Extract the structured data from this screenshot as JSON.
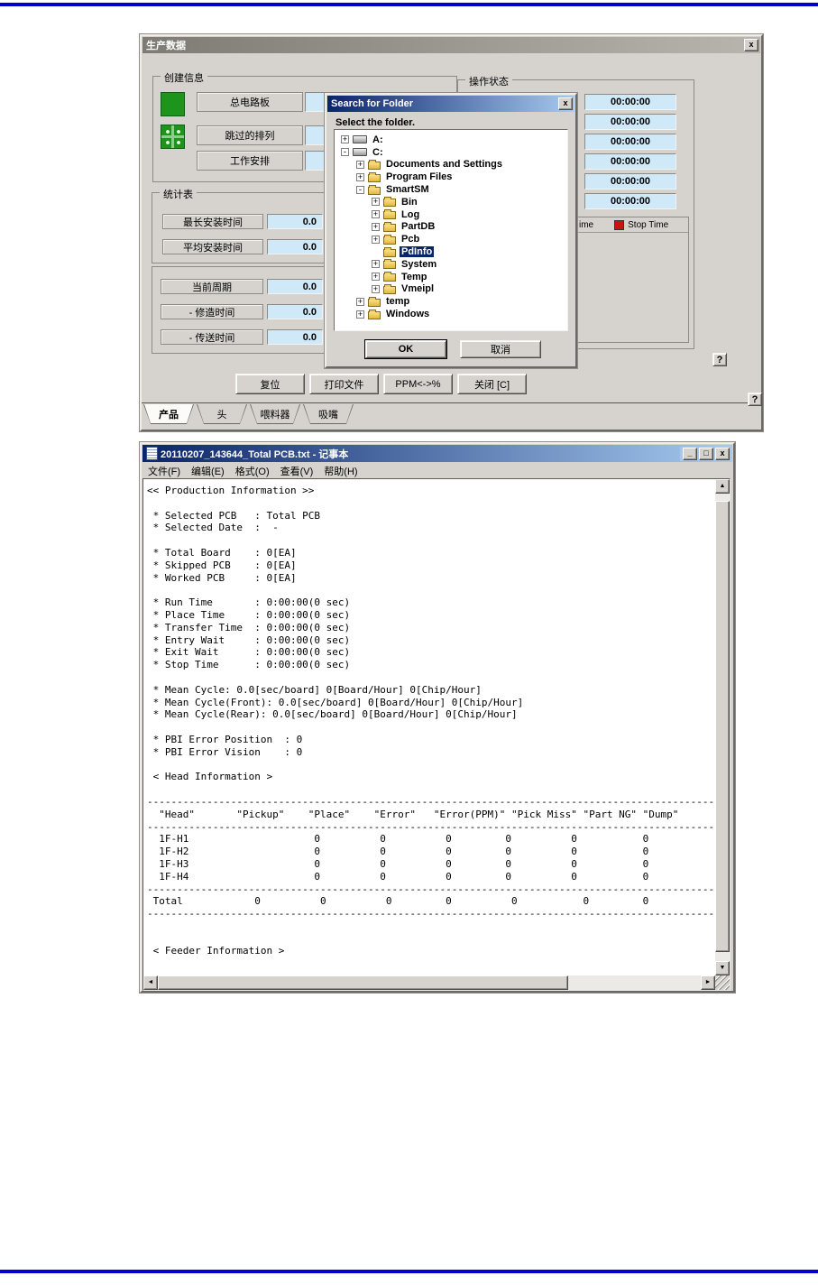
{
  "page": {
    "top_rule_color": "#0000cf",
    "bottom_rule_color": "#0000cf"
  },
  "icons": {
    "close": "x",
    "minimize": "_",
    "maximize": "□",
    "scroll_up": "▲",
    "scroll_down": "▼",
    "scroll_left": "◄",
    "scroll_right": "►"
  },
  "production_window": {
    "title": "生产数据",
    "creation_group": {
      "label": "创建信息",
      "rows": [
        {
          "button": "总电路板"
        },
        {
          "button": "跳过的排列"
        },
        {
          "button": "工作安排"
        }
      ]
    },
    "status_group": {
      "label": "操作状态",
      "time_values": [
        "00:00:00",
        "00:00:00",
        "00:00:00",
        "00:00:00",
        "00:00:00",
        "00:00:00"
      ],
      "legend": {
        "left_partial_label": "ime",
        "stop_label": "Stop Time",
        "stop_color": "#cc1111"
      }
    },
    "stats_group": {
      "label": "统计表",
      "rows": [
        {
          "label": "最长安装时间",
          "value": "0.0"
        },
        {
          "label": "平均安装时间",
          "value": "0.0"
        }
      ]
    },
    "cycle_group": {
      "rows": [
        {
          "label": "当前周期",
          "value": "0.0"
        },
        {
          "label": "- 修造时间",
          "value": "0.0"
        },
        {
          "label": "- 传送时间",
          "value": "0.0"
        }
      ]
    },
    "action_buttons": [
      "复位",
      "打印文件",
      "PPM<->%",
      "关闭 [C]"
    ],
    "help_button": "?",
    "tabs": [
      {
        "label": "产品",
        "active": true
      },
      {
        "label": "头",
        "active": false
      },
      {
        "label": "喂料器",
        "active": false
      },
      {
        "label": "吸嘴",
        "active": false
      }
    ]
  },
  "folder_dialog": {
    "title": "Search for Folder",
    "prompt": "Select the folder.",
    "ok_button": "OK",
    "cancel_button": "取消",
    "tree": [
      {
        "label": "A:",
        "level": 0,
        "expander": "plus",
        "icon": "drive",
        "selected": false
      },
      {
        "label": "C:",
        "level": 0,
        "expander": "minus",
        "icon": "drive",
        "selected": false
      },
      {
        "label": "Documents and Settings",
        "level": 1,
        "expander": "plus",
        "icon": "folder",
        "selected": false
      },
      {
        "label": "Program Files",
        "level": 1,
        "expander": "plus",
        "icon": "folder",
        "selected": false
      },
      {
        "label": "SmartSM",
        "level": 1,
        "expander": "minus",
        "icon": "folder",
        "selected": false
      },
      {
        "label": "Bin",
        "level": 2,
        "expander": "plus",
        "icon": "folder",
        "selected": false
      },
      {
        "label": "Log",
        "level": 2,
        "expander": "plus",
        "icon": "folder",
        "selected": false
      },
      {
        "label": "PartDB",
        "level": 2,
        "expander": "plus",
        "icon": "folder",
        "selected": false
      },
      {
        "label": "Pcb",
        "level": 2,
        "expander": "plus",
        "icon": "folder",
        "selected": false
      },
      {
        "label": "PdInfo",
        "level": 2,
        "expander": "none",
        "icon": "folder-open",
        "selected": true
      },
      {
        "label": "System",
        "level": 2,
        "expander": "plus",
        "icon": "folder",
        "selected": false
      },
      {
        "label": "Temp",
        "level": 2,
        "expander": "plus",
        "icon": "folder",
        "selected": false
      },
      {
        "label": "Vmeipl",
        "level": 2,
        "expander": "plus",
        "icon": "folder",
        "selected": false
      },
      {
        "label": "temp",
        "level": 1,
        "expander": "plus",
        "icon": "folder",
        "selected": false
      },
      {
        "label": "Windows",
        "level": 1,
        "expander": "plus",
        "icon": "folder",
        "selected": false
      }
    ]
  },
  "notepad": {
    "title": "20110207_143644_Total PCB.txt - 记事本",
    "menus": [
      "文件(F)",
      "编辑(E)",
      "格式(O)",
      "查看(V)",
      "帮助(H)"
    ],
    "lines": [
      "<< Production Information >>",
      "",
      " * Selected PCB   : Total PCB",
      " * Selected Date  :  -",
      "",
      " * Total Board    : 0[EA]",
      " * Skipped PCB    : 0[EA]",
      " * Worked PCB     : 0[EA]",
      "",
      " * Run Time       : 0:00:00(0 sec)",
      " * Place Time     : 0:00:00(0 sec)",
      " * Transfer Time  : 0:00:00(0 sec)",
      " * Entry Wait     : 0:00:00(0 sec)",
      " * Exit Wait      : 0:00:00(0 sec)",
      " * Stop Time      : 0:00:00(0 sec)",
      "",
      " * Mean Cycle: 0.0[sec/board] 0[Board/Hour] 0[Chip/Hour]",
      " * Mean Cycle(Front): 0.0[sec/board] 0[Board/Hour] 0[Chip/Hour]",
      " * Mean Cycle(Rear): 0.0[sec/board] 0[Board/Hour] 0[Chip/Hour]",
      "",
      " * PBI Error Position  : 0",
      " * PBI Error Vision    : 0",
      "",
      " < Head Information >",
      "",
      "--------------------------------------------------------------------------------------------------------",
      "  \"Head\"       \"Pickup\"    \"Place\"    \"Error\"   \"Error(PPM)\" \"Pick Miss\" \"Part NG\" \"Dump\"",
      "--------------------------------------------------------------------------------------------------------",
      "  1F-H1                     0          0          0         0          0           0           0",
      "  1F-H2                     0          0          0         0          0           0           0",
      "  1F-H3                     0          0          0         0          0           0           0",
      "  1F-H4                     0          0          0         0          0           0           0",
      "--------------------------------------------------------------------------------------------------------",
      " Total            0          0          0         0          0           0         0",
      "--------------------------------------------------------------------------------------------------------",
      "",
      "",
      " < Feeder Information >"
    ]
  }
}
